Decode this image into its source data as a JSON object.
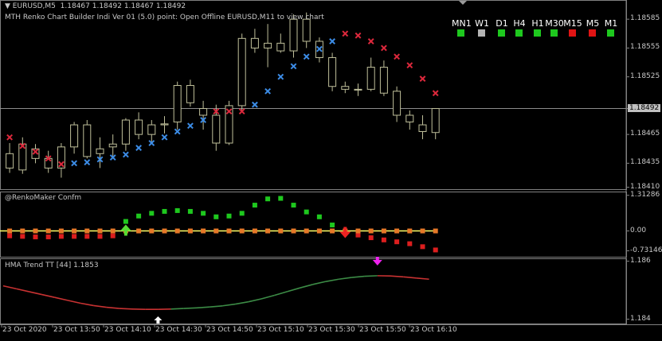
{
  "header": {
    "symbol": "EURUSD,M5",
    "ohlc": "1.18467 1.18492 1.18467 1.18492",
    "indicator_line": "MTH Renko Chart Builder Indi Ver 01 (5.0) point: Open Offline EURUSD,M11 to view chart"
  },
  "timeframes": [
    {
      "label": "MN1",
      "color": "#1ec81e"
    },
    {
      "label": "W1",
      "color": "#b4b4b4"
    },
    {
      "label": "D1",
      "color": "#1ec81e"
    },
    {
      "label": "H4",
      "color": "#1ec81e"
    },
    {
      "label": "H1",
      "color": "#1ec81e"
    },
    {
      "label": "M30",
      "color": "#1ec81e"
    },
    {
      "label": "M15",
      "color": "#e01414"
    },
    {
      "label": "M5",
      "color": "#e01414"
    },
    {
      "label": "M1",
      "color": "#1ec81e"
    }
  ],
  "current_price": "1.18492",
  "colors": {
    "bull_marker": "#3c8ce6",
    "bear_marker": "#dc283c",
    "green_dot": "#1ec81e",
    "red_dot": "#dc1e1e",
    "orange_dot": "#e67828",
    "zero_line": "#ffff66",
    "hma_up": "#3c8c46",
    "hma_down": "#c83232",
    "candle": "#bfbf9a"
  },
  "chart_data": [
    {
      "type": "candlestick",
      "title": "EURUSD,M5",
      "ylim": [
        1.18408,
        1.18605
      ],
      "yticks": [
        "1.18565",
        "1.18555",
        "1.18525",
        "1.18465",
        "1.18435",
        "1.18405"
      ],
      "ytick_values": [
        1.18585,
        1.18555,
        1.18525,
        1.18492,
        1.18465,
        1.18435,
        1.1841
      ],
      "ytick_labels": [
        "1.18585",
        "1.18555",
        "1.18525",
        "1.18492",
        "1.18465",
        "1.18435",
        "1.18410"
      ],
      "candles": [
        {
          "o": 1.18445,
          "h": 1.18456,
          "l": 1.18425,
          "c": 1.1843
        },
        {
          "o": 1.18428,
          "h": 1.18462,
          "l": 1.18424,
          "c": 1.18455
        },
        {
          "o": 1.1845,
          "h": 1.18455,
          "l": 1.18435,
          "c": 1.1844
        },
        {
          "o": 1.1844,
          "h": 1.18448,
          "l": 1.18425,
          "c": 1.1843
        },
        {
          "o": 1.1843,
          "h": 1.18456,
          "l": 1.1842,
          "c": 1.18452
        },
        {
          "o": 1.18452,
          "h": 1.18478,
          "l": 1.18445,
          "c": 1.18475
        },
        {
          "o": 1.18475,
          "h": 1.1848,
          "l": 1.1844,
          "c": 1.18442
        },
        {
          "o": 1.18445,
          "h": 1.18462,
          "l": 1.1843,
          "c": 1.1845
        },
        {
          "o": 1.18452,
          "h": 1.18465,
          "l": 1.1844,
          "c": 1.18455
        },
        {
          "o": 1.18455,
          "h": 1.18482,
          "l": 1.18448,
          "c": 1.1848
        },
        {
          "o": 1.1848,
          "h": 1.18488,
          "l": 1.1846,
          "c": 1.18465
        },
        {
          "o": 1.18465,
          "h": 1.1848,
          "l": 1.18455,
          "c": 1.18475
        },
        {
          "o": 1.18475,
          "h": 1.18484,
          "l": 1.18466,
          "c": 1.18476
        },
        {
          "o": 1.18478,
          "h": 1.1852,
          "l": 1.1847,
          "c": 1.18516
        },
        {
          "o": 1.18516,
          "h": 1.18522,
          "l": 1.18494,
          "c": 1.18498
        },
        {
          "o": 1.18492,
          "h": 1.185,
          "l": 1.1847,
          "c": 1.18485
        },
        {
          "o": 1.18485,
          "h": 1.18496,
          "l": 1.18448,
          "c": 1.18456
        },
        {
          "o": 1.18456,
          "h": 1.185,
          "l": 1.18454,
          "c": 1.18495
        },
        {
          "o": 1.18495,
          "h": 1.1857,
          "l": 1.1849,
          "c": 1.18565
        },
        {
          "o": 1.18565,
          "h": 1.18575,
          "l": 1.1855,
          "c": 1.18555
        },
        {
          "o": 1.18555,
          "h": 1.1858,
          "l": 1.18535,
          "c": 1.1856
        },
        {
          "o": 1.1856,
          "h": 1.1857,
          "l": 1.1855,
          "c": 1.18552
        },
        {
          "o": 1.18552,
          "h": 1.1859,
          "l": 1.18545,
          "c": 1.18585
        },
        {
          "o": 1.18585,
          "h": 1.18592,
          "l": 1.18555,
          "c": 1.18562
        },
        {
          "o": 1.18562,
          "h": 1.18566,
          "l": 1.1854,
          "c": 1.18545
        },
        {
          "o": 1.18545,
          "h": 1.1855,
          "l": 1.1851,
          "c": 1.18515
        },
        {
          "o": 1.18515,
          "h": 1.1852,
          "l": 1.18508,
          "c": 1.18512
        },
        {
          "o": 1.18512,
          "h": 1.18518,
          "l": 1.18505,
          "c": 1.18512
        },
        {
          "o": 1.18512,
          "h": 1.18545,
          "l": 1.1851,
          "c": 1.18535
        },
        {
          "o": 1.18535,
          "h": 1.18542,
          "l": 1.18505,
          "c": 1.18508
        },
        {
          "o": 1.1851,
          "h": 1.18515,
          "l": 1.18478,
          "c": 1.18485
        },
        {
          "o": 1.18485,
          "h": 1.1849,
          "l": 1.1847,
          "c": 1.18478
        },
        {
          "o": 1.18475,
          "h": 1.18485,
          "l": 1.1846,
          "c": 1.18468
        },
        {
          "o": 1.18467,
          "h": 1.18492,
          "l": 1.1846,
          "c": 1.18492
        }
      ],
      "markers": [
        {
          "i": 0,
          "type": "bear",
          "y": 1.18462
        },
        {
          "i": 1,
          "type": "bear",
          "y": 1.18453
        },
        {
          "i": 2,
          "type": "bear",
          "y": 1.18447
        },
        {
          "i": 3,
          "type": "bear",
          "y": 1.1844
        },
        {
          "i": 4,
          "type": "bear",
          "y": 1.18434
        },
        {
          "i": 5,
          "type": "bull",
          "y": 1.18435
        },
        {
          "i": 6,
          "type": "bull",
          "y": 1.18436
        },
        {
          "i": 7,
          "type": "bull",
          "y": 1.18439
        },
        {
          "i": 8,
          "type": "bull",
          "y": 1.18441
        },
        {
          "i": 9,
          "type": "bull",
          "y": 1.18444
        },
        {
          "i": 10,
          "type": "bull",
          "y": 1.18451
        },
        {
          "i": 11,
          "type": "bull",
          "y": 1.18456
        },
        {
          "i": 12,
          "type": "bull",
          "y": 1.18462
        },
        {
          "i": 13,
          "type": "bull",
          "y": 1.18468
        },
        {
          "i": 14,
          "type": "bull",
          "y": 1.18474
        },
        {
          "i": 15,
          "type": "bull",
          "y": 1.1848
        },
        {
          "i": 16,
          "type": "bear",
          "y": 1.18489
        },
        {
          "i": 17,
          "type": "bear",
          "y": 1.18489
        },
        {
          "i": 18,
          "type": "bear",
          "y": 1.18489
        },
        {
          "i": 19,
          "type": "bull",
          "y": 1.18496
        },
        {
          "i": 20,
          "type": "bull",
          "y": 1.1851
        },
        {
          "i": 21,
          "type": "bull",
          "y": 1.18525
        },
        {
          "i": 22,
          "type": "bull",
          "y": 1.18536
        },
        {
          "i": 23,
          "type": "bull",
          "y": 1.18546
        },
        {
          "i": 24,
          "type": "bull",
          "y": 1.18554
        },
        {
          "i": 25,
          "type": "bull",
          "y": 1.18562
        },
        {
          "i": 26,
          "type": "bear",
          "y": 1.1857
        },
        {
          "i": 27,
          "type": "bear",
          "y": 1.18568
        },
        {
          "i": 28,
          "type": "bear",
          "y": 1.18562
        },
        {
          "i": 29,
          "type": "bear",
          "y": 1.18555
        },
        {
          "i": 30,
          "type": "bear",
          "y": 1.18546
        },
        {
          "i": 31,
          "type": "bear",
          "y": 1.18537
        },
        {
          "i": 32,
          "type": "bear",
          "y": 1.18523
        },
        {
          "i": 33,
          "type": "bear",
          "y": 1.18508
        }
      ]
    },
    {
      "type": "scatter",
      "title": "@RenkoMaker Confm",
      "ylim": [
        -0.95,
        1.45
      ],
      "yticks": [
        1.31286,
        0.0,
        -0.73146
      ],
      "ytick_labels": [
        "1.31286",
        "0.00",
        "-0.73146"
      ],
      "green_dots": [
        null,
        null,
        null,
        null,
        null,
        null,
        null,
        null,
        null,
        0.35,
        0.55,
        0.65,
        0.72,
        0.75,
        0.72,
        0.65,
        0.52,
        0.55,
        0.65,
        0.95,
        1.18,
        1.2,
        0.95,
        0.7,
        0.52,
        0.22,
        null,
        null,
        null,
        null,
        null,
        null,
        null,
        null
      ],
      "red_dots": [
        -0.18,
        -0.2,
        -0.22,
        -0.22,
        -0.2,
        -0.2,
        -0.2,
        -0.2,
        -0.18,
        null,
        null,
        null,
        null,
        null,
        null,
        null,
        null,
        null,
        null,
        null,
        null,
        null,
        null,
        null,
        null,
        null,
        -0.05,
        -0.15,
        -0.25,
        -0.33,
        -0.4,
        -0.47,
        -0.58,
        -0.7
      ],
      "orange_dots": [
        0,
        0,
        0,
        0,
        0,
        0,
        0,
        0,
        0,
        0,
        0,
        0,
        0,
        0,
        0,
        0,
        0,
        0,
        0,
        0,
        0,
        0,
        0,
        0,
        0,
        0,
        0,
        0,
        0,
        0,
        0,
        0,
        0,
        0
      ],
      "arrows": [
        {
          "i": 9,
          "dir": "up"
        },
        {
          "i": 26,
          "dir": "down"
        }
      ]
    },
    {
      "type": "line",
      "title": "HMA Trend TT [44] 1.1853",
      "ylim": [
        1.18385,
        1.1861
      ],
      "yticks": [
        1.186,
        1.184
      ],
      "ytick_labels": [
        "1.186",
        "1.184"
      ],
      "values": [
        1.18515,
        1.18505,
        1.18495,
        1.18485,
        1.18475,
        1.18465,
        1.18455,
        1.18447,
        1.18441,
        1.18437,
        1.18435,
        1.18434,
        1.18434,
        1.18435,
        1.18437,
        1.18439,
        1.18442,
        1.18446,
        1.18452,
        1.1846,
        1.1847,
        1.18482,
        1.18495,
        1.18508,
        1.1852,
        1.1853,
        1.18538,
        1.18544,
        1.18548,
        1.1855,
        1.18549,
        1.18546,
        1.18542,
        1.18538
      ],
      "trend": [
        "down",
        "down",
        "down",
        "down",
        "down",
        "down",
        "down",
        "down",
        "down",
        "down",
        "down",
        "down",
        "down",
        "up",
        "up",
        "up",
        "up",
        "up",
        "up",
        "up",
        "up",
        "up",
        "up",
        "up",
        "up",
        "up",
        "up",
        "up",
        "up",
        "down",
        "down",
        "down",
        "down",
        "down"
      ],
      "arrows": [
        {
          "i": 12,
          "dir": "up"
        },
        {
          "i": 29,
          "dir": "down"
        }
      ]
    }
  ],
  "x_labels": [
    "23 Oct 2020",
    "23 Oct 13:50",
    "23 Oct 14:10",
    "23 Oct 14:30",
    "23 Oct 14:50",
    "23 Oct 15:10",
    "23 Oct 15:30",
    "23 Oct 15:50",
    "23 Oct 16:10"
  ]
}
